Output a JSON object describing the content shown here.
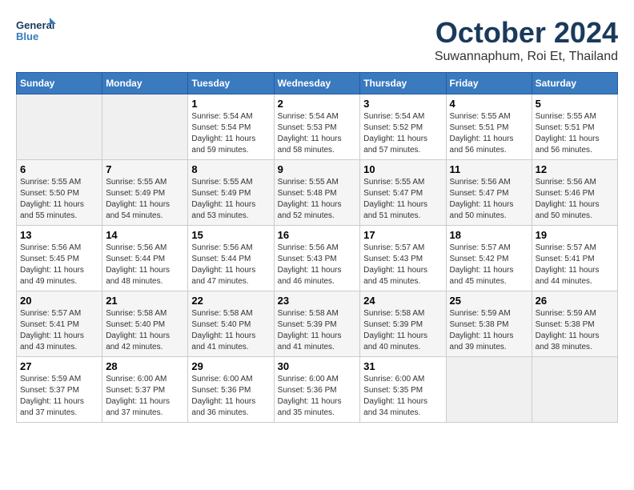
{
  "logo": {
    "line1": "General",
    "line2": "Blue"
  },
  "title": "October 2024",
  "location": "Suwannaphum, Roi Et, Thailand",
  "weekdays": [
    "Sunday",
    "Monday",
    "Tuesday",
    "Wednesday",
    "Thursday",
    "Friday",
    "Saturday"
  ],
  "weeks": [
    [
      {
        "day": "",
        "sunrise": "",
        "sunset": "",
        "daylight": ""
      },
      {
        "day": "",
        "sunrise": "",
        "sunset": "",
        "daylight": ""
      },
      {
        "day": "1",
        "sunrise": "Sunrise: 5:54 AM",
        "sunset": "Sunset: 5:54 PM",
        "daylight": "Daylight: 11 hours and 59 minutes."
      },
      {
        "day": "2",
        "sunrise": "Sunrise: 5:54 AM",
        "sunset": "Sunset: 5:53 PM",
        "daylight": "Daylight: 11 hours and 58 minutes."
      },
      {
        "day": "3",
        "sunrise": "Sunrise: 5:54 AM",
        "sunset": "Sunset: 5:52 PM",
        "daylight": "Daylight: 11 hours and 57 minutes."
      },
      {
        "day": "4",
        "sunrise": "Sunrise: 5:55 AM",
        "sunset": "Sunset: 5:51 PM",
        "daylight": "Daylight: 11 hours and 56 minutes."
      },
      {
        "day": "5",
        "sunrise": "Sunrise: 5:55 AM",
        "sunset": "Sunset: 5:51 PM",
        "daylight": "Daylight: 11 hours and 56 minutes."
      }
    ],
    [
      {
        "day": "6",
        "sunrise": "Sunrise: 5:55 AM",
        "sunset": "Sunset: 5:50 PM",
        "daylight": "Daylight: 11 hours and 55 minutes."
      },
      {
        "day": "7",
        "sunrise": "Sunrise: 5:55 AM",
        "sunset": "Sunset: 5:49 PM",
        "daylight": "Daylight: 11 hours and 54 minutes."
      },
      {
        "day": "8",
        "sunrise": "Sunrise: 5:55 AM",
        "sunset": "Sunset: 5:49 PM",
        "daylight": "Daylight: 11 hours and 53 minutes."
      },
      {
        "day": "9",
        "sunrise": "Sunrise: 5:55 AM",
        "sunset": "Sunset: 5:48 PM",
        "daylight": "Daylight: 11 hours and 52 minutes."
      },
      {
        "day": "10",
        "sunrise": "Sunrise: 5:55 AM",
        "sunset": "Sunset: 5:47 PM",
        "daylight": "Daylight: 11 hours and 51 minutes."
      },
      {
        "day": "11",
        "sunrise": "Sunrise: 5:56 AM",
        "sunset": "Sunset: 5:47 PM",
        "daylight": "Daylight: 11 hours and 50 minutes."
      },
      {
        "day": "12",
        "sunrise": "Sunrise: 5:56 AM",
        "sunset": "Sunset: 5:46 PM",
        "daylight": "Daylight: 11 hours and 50 minutes."
      }
    ],
    [
      {
        "day": "13",
        "sunrise": "Sunrise: 5:56 AM",
        "sunset": "Sunset: 5:45 PM",
        "daylight": "Daylight: 11 hours and 49 minutes."
      },
      {
        "day": "14",
        "sunrise": "Sunrise: 5:56 AM",
        "sunset": "Sunset: 5:44 PM",
        "daylight": "Daylight: 11 hours and 48 minutes."
      },
      {
        "day": "15",
        "sunrise": "Sunrise: 5:56 AM",
        "sunset": "Sunset: 5:44 PM",
        "daylight": "Daylight: 11 hours and 47 minutes."
      },
      {
        "day": "16",
        "sunrise": "Sunrise: 5:56 AM",
        "sunset": "Sunset: 5:43 PM",
        "daylight": "Daylight: 11 hours and 46 minutes."
      },
      {
        "day": "17",
        "sunrise": "Sunrise: 5:57 AM",
        "sunset": "Sunset: 5:43 PM",
        "daylight": "Daylight: 11 hours and 45 minutes."
      },
      {
        "day": "18",
        "sunrise": "Sunrise: 5:57 AM",
        "sunset": "Sunset: 5:42 PM",
        "daylight": "Daylight: 11 hours and 45 minutes."
      },
      {
        "day": "19",
        "sunrise": "Sunrise: 5:57 AM",
        "sunset": "Sunset: 5:41 PM",
        "daylight": "Daylight: 11 hours and 44 minutes."
      }
    ],
    [
      {
        "day": "20",
        "sunrise": "Sunrise: 5:57 AM",
        "sunset": "Sunset: 5:41 PM",
        "daylight": "Daylight: 11 hours and 43 minutes."
      },
      {
        "day": "21",
        "sunrise": "Sunrise: 5:58 AM",
        "sunset": "Sunset: 5:40 PM",
        "daylight": "Daylight: 11 hours and 42 minutes."
      },
      {
        "day": "22",
        "sunrise": "Sunrise: 5:58 AM",
        "sunset": "Sunset: 5:40 PM",
        "daylight": "Daylight: 11 hours and 41 minutes."
      },
      {
        "day": "23",
        "sunrise": "Sunrise: 5:58 AM",
        "sunset": "Sunset: 5:39 PM",
        "daylight": "Daylight: 11 hours and 41 minutes."
      },
      {
        "day": "24",
        "sunrise": "Sunrise: 5:58 AM",
        "sunset": "Sunset: 5:39 PM",
        "daylight": "Daylight: 11 hours and 40 minutes."
      },
      {
        "day": "25",
        "sunrise": "Sunrise: 5:59 AM",
        "sunset": "Sunset: 5:38 PM",
        "daylight": "Daylight: 11 hours and 39 minutes."
      },
      {
        "day": "26",
        "sunrise": "Sunrise: 5:59 AM",
        "sunset": "Sunset: 5:38 PM",
        "daylight": "Daylight: 11 hours and 38 minutes."
      }
    ],
    [
      {
        "day": "27",
        "sunrise": "Sunrise: 5:59 AM",
        "sunset": "Sunset: 5:37 PM",
        "daylight": "Daylight: 11 hours and 37 minutes."
      },
      {
        "day": "28",
        "sunrise": "Sunrise: 6:00 AM",
        "sunset": "Sunset: 5:37 PM",
        "daylight": "Daylight: 11 hours and 37 minutes."
      },
      {
        "day": "29",
        "sunrise": "Sunrise: 6:00 AM",
        "sunset": "Sunset: 5:36 PM",
        "daylight": "Daylight: 11 hours and 36 minutes."
      },
      {
        "day": "30",
        "sunrise": "Sunrise: 6:00 AM",
        "sunset": "Sunset: 5:36 PM",
        "daylight": "Daylight: 11 hours and 35 minutes."
      },
      {
        "day": "31",
        "sunrise": "Sunrise: 6:00 AM",
        "sunset": "Sunset: 5:35 PM",
        "daylight": "Daylight: 11 hours and 34 minutes."
      },
      {
        "day": "",
        "sunrise": "",
        "sunset": "",
        "daylight": ""
      },
      {
        "day": "",
        "sunrise": "",
        "sunset": "",
        "daylight": ""
      }
    ]
  ]
}
